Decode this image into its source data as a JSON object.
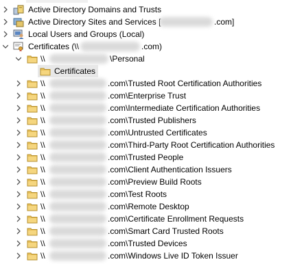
{
  "tree": {
    "top_nodes": [
      {
        "label": "Active Directory Domains and Trusts"
      },
      {
        "label": "Active Directory Sites and Services [",
        "suffix": ".com]"
      },
      {
        "label": "Local Users and Groups (Local)"
      },
      {
        "label": "Certificates (\\\\",
        "suffix": ".com)"
      }
    ],
    "personal": {
      "prefix": "\\\\",
      "suffix": "\\Personal"
    },
    "selected_child": {
      "label": "Certificates"
    },
    "stores": [
      {
        "prefix": "\\\\",
        "suffix": ".com\\Trusted Root Certification Authorities"
      },
      {
        "prefix": "\\\\",
        "suffix": ".com\\Enterprise Trust"
      },
      {
        "prefix": "\\\\",
        "suffix": ".com\\Intermediate Certification Authorities"
      },
      {
        "prefix": "\\\\",
        "suffix": ".com\\Trusted Publishers"
      },
      {
        "prefix": "\\\\",
        "suffix": ".com\\Untrusted Certificates"
      },
      {
        "prefix": "\\\\",
        "suffix": ".com\\Third-Party Root Certification Authorities"
      },
      {
        "prefix": "\\\\",
        "suffix": ".com\\Trusted People"
      },
      {
        "prefix": "\\\\",
        "suffix": ".com\\Client Authentication Issuers"
      },
      {
        "prefix": "\\\\",
        "suffix": ".com\\Preview Build Roots"
      },
      {
        "prefix": "\\\\",
        "suffix": ".com\\Test Roots"
      },
      {
        "prefix": "\\\\",
        "suffix": ".com\\Remote Desktop"
      },
      {
        "prefix": "\\\\",
        "suffix": ".com\\Certificate Enrollment Requests"
      },
      {
        "prefix": "\\\\",
        "suffix": ".com\\Smart Card Trusted Roots"
      },
      {
        "prefix": "\\\\",
        "suffix": ".com\\Trusted Devices"
      },
      {
        "prefix": "\\\\",
        "suffix": ".com\\Windows Live ID Token Issuer"
      }
    ]
  },
  "icons": {
    "expand": "chevron-right-icon",
    "collapse": "chevron-down-icon",
    "folder": "folder-icon",
    "domains": "ad-domains-icon",
    "sites": "ad-sites-icon",
    "users": "users-icon",
    "cert": "certificate-icon"
  },
  "colors": {
    "folder": "#e8c05a",
    "selection": "#e8e8e8"
  }
}
